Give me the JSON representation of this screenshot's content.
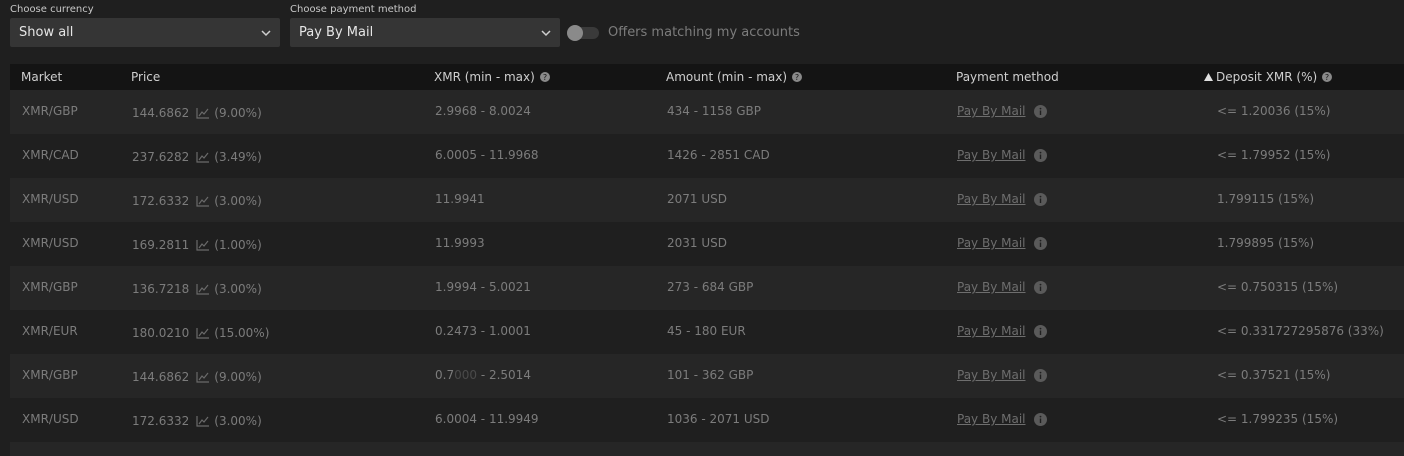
{
  "filters": {
    "currency_label": "Choose currency",
    "currency_value": "Show all",
    "payment_label": "Choose payment method",
    "payment_value": "Pay By Mail",
    "toggle_label": "Offers matching my accounts"
  },
  "table": {
    "headers": {
      "market": "Market",
      "price": "Price",
      "xmr": "XMR (min - max)",
      "amount": "Amount (min - max)",
      "payment": "Payment method",
      "deposit": "Deposit XMR (%)"
    },
    "rows": [
      {
        "market": "XMR/GBP",
        "price": "144.6862",
        "pct": "(9.00%)",
        "xmr": "2.9968 - 8.0024",
        "amount": "434 - 1158 GBP",
        "payment": "Pay By Mail",
        "deposit": "<= 1.20036 (15%)"
      },
      {
        "market": "XMR/CAD",
        "price": "237.6282",
        "pct": "(3.49%)",
        "xmr": "6.0005 - 11.9968",
        "amount": "1426 - 2851 CAD",
        "payment": "Pay By Mail",
        "deposit": "<= 1.79952 (15%)"
      },
      {
        "market": "XMR/USD",
        "price": "172.6332",
        "pct": "(3.00%)",
        "xmr": "11.9941",
        "amount": "2071 USD",
        "payment": "Pay By Mail",
        "deposit": "1.799115 (15%)"
      },
      {
        "market": "XMR/USD",
        "price": "169.2811",
        "pct": "(1.00%)",
        "xmr": "11.9993",
        "amount": "2031 USD",
        "payment": "Pay By Mail",
        "deposit": "1.799895 (15%)"
      },
      {
        "market": "XMR/GBP",
        "price": "136.7218",
        "pct": "(3.00%)",
        "xmr": "1.9994 - 5.0021",
        "amount": "273 - 684 GBP",
        "payment": "Pay By Mail",
        "deposit": "<= 0.750315 (15%)"
      },
      {
        "market": "XMR/EUR",
        "price": "180.0210",
        "pct": "(15.00%)",
        "xmr": "0.2473 - 1.0001",
        "amount": "45 - 180 EUR",
        "payment": "Pay By Mail",
        "deposit": "<= 0.331727295876 (33%)"
      },
      {
        "market": "XMR/GBP",
        "price": "144.6862",
        "pct": "(9.00%)",
        "xmr": "0.7",
        "xmr_dim": "000",
        "xmr_rest": " - 2.5014",
        "amount": "101 - 362 GBP",
        "payment": "Pay By Mail",
        "deposit": "<= 0.37521 (15%)"
      },
      {
        "market": "XMR/USD",
        "price": "172.6332",
        "pct": "(3.00%)",
        "xmr": "6.0004 - 11.9949",
        "amount": "1036 - 2071 USD",
        "payment": "Pay By Mail",
        "deposit": "<= 1.799235 (15%)"
      }
    ]
  },
  "colors": {
    "background": "#1f1f1f",
    "row_alt": "#262626",
    "header_bg": "#141414",
    "select_bg": "#353535"
  },
  "icons": [
    "chevron-down-icon",
    "help-icon",
    "sort-up-icon",
    "chart-icon",
    "info-icon"
  ]
}
